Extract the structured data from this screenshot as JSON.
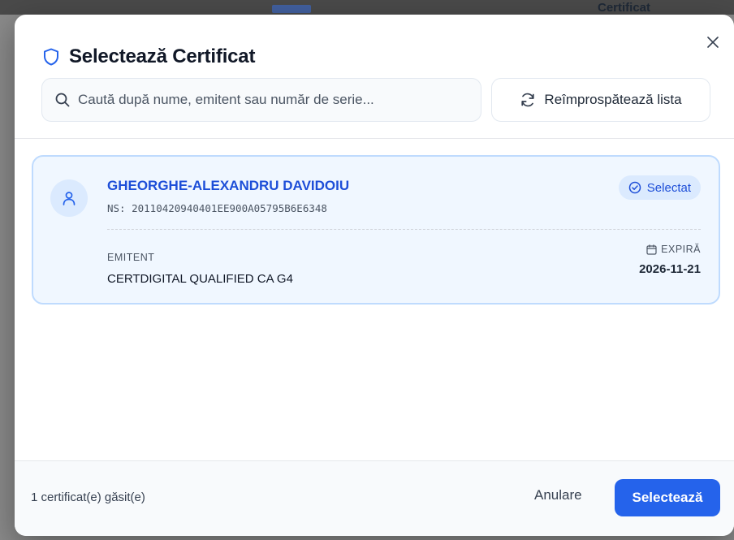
{
  "background": {
    "partial_title": "Certificat"
  },
  "dialog": {
    "title": "Selectează Certificat",
    "close_icon": "close-icon",
    "search": {
      "placeholder": "Caută după nume, emitent sau număr de serie...",
      "value": ""
    },
    "refresh_label": "Reîmprospătează lista"
  },
  "certificates": [
    {
      "name": "GHEORGHE-ALEXANDRU DAVIDOIU",
      "serial": "NS: 20110420940401EE900A05795B6E6348",
      "badge": "Selectat",
      "issuer_label": "EMITENT",
      "issuer": "CERTDIGITAL QUALIFIED CA G4",
      "expiry_label": "EXPIRĂ",
      "expiry": "2026-11-21"
    }
  ],
  "footer": {
    "count_text": "1 certificat(e) găsit(e)",
    "cancel_label": "Anulare",
    "select_label": "Selectează"
  },
  "colors": {
    "accent": "#2563eb",
    "selected_bg": "#f0f7ff",
    "selected_border": "#bfdbfe"
  }
}
